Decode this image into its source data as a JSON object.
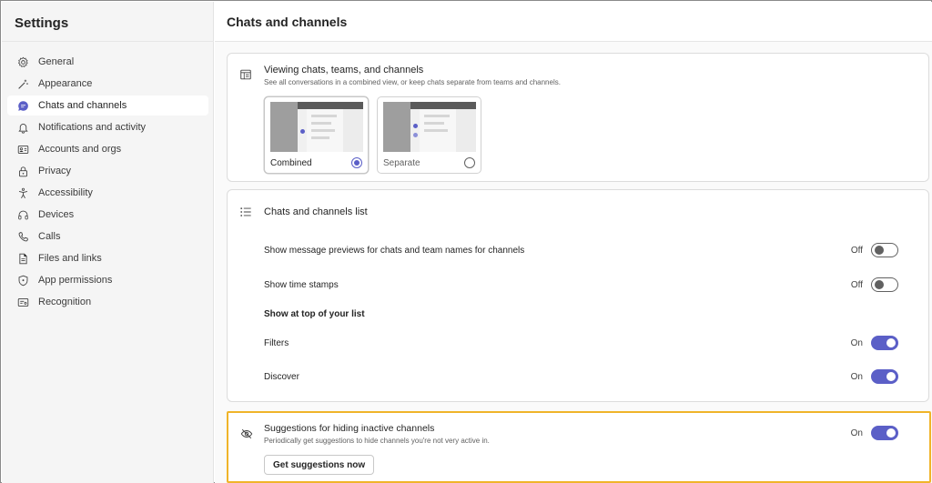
{
  "sidebar": {
    "title": "Settings",
    "items": [
      {
        "label": "General",
        "icon": "gear-icon",
        "active": false
      },
      {
        "label": "Appearance",
        "icon": "magic-wand-icon",
        "active": false
      },
      {
        "label": "Chats and channels",
        "icon": "chat-icon",
        "active": true
      },
      {
        "label": "Notifications and activity",
        "icon": "bell-icon",
        "active": false
      },
      {
        "label": "Accounts and orgs",
        "icon": "id-card-icon",
        "active": false
      },
      {
        "label": "Privacy",
        "icon": "lock-icon",
        "active": false
      },
      {
        "label": "Accessibility",
        "icon": "accessibility-icon",
        "active": false
      },
      {
        "label": "Devices",
        "icon": "headset-icon",
        "active": false
      },
      {
        "label": "Calls",
        "icon": "phone-icon",
        "active": false
      },
      {
        "label": "Files and links",
        "icon": "document-icon",
        "active": false
      },
      {
        "label": "App permissions",
        "icon": "shield-icon",
        "active": false
      },
      {
        "label": "Recognition",
        "icon": "badge-icon",
        "active": false
      }
    ]
  },
  "main": {
    "title": "Chats and channels",
    "view_card": {
      "title": "Viewing chats, teams, and channels",
      "subtitle": "See all conversations in a combined view, or keep chats separate from teams and channels.",
      "options": [
        {
          "label": "Combined",
          "selected": true
        },
        {
          "label": "Separate",
          "selected": false
        }
      ]
    },
    "list_card": {
      "title": "Chats and channels list",
      "rows": [
        {
          "label": "Show message previews for chats and team names for channels",
          "state": "Off",
          "on": false
        },
        {
          "label": "Show time stamps",
          "state": "Off",
          "on": false
        }
      ],
      "section_heading": "Show at top of your list",
      "top_rows": [
        {
          "label": "Filters",
          "state": "On",
          "on": true
        },
        {
          "label": "Discover",
          "state": "On",
          "on": true
        }
      ]
    },
    "suggest_card": {
      "title": "Suggestions for hiding inactive channels",
      "subtitle": "Periodically get suggestions to hide channels you're not very active in.",
      "state": "On",
      "on": true,
      "button_label": "Get suggestions now"
    }
  },
  "colors": {
    "accent": "#5b5fc7",
    "highlight": "#f0b429"
  }
}
